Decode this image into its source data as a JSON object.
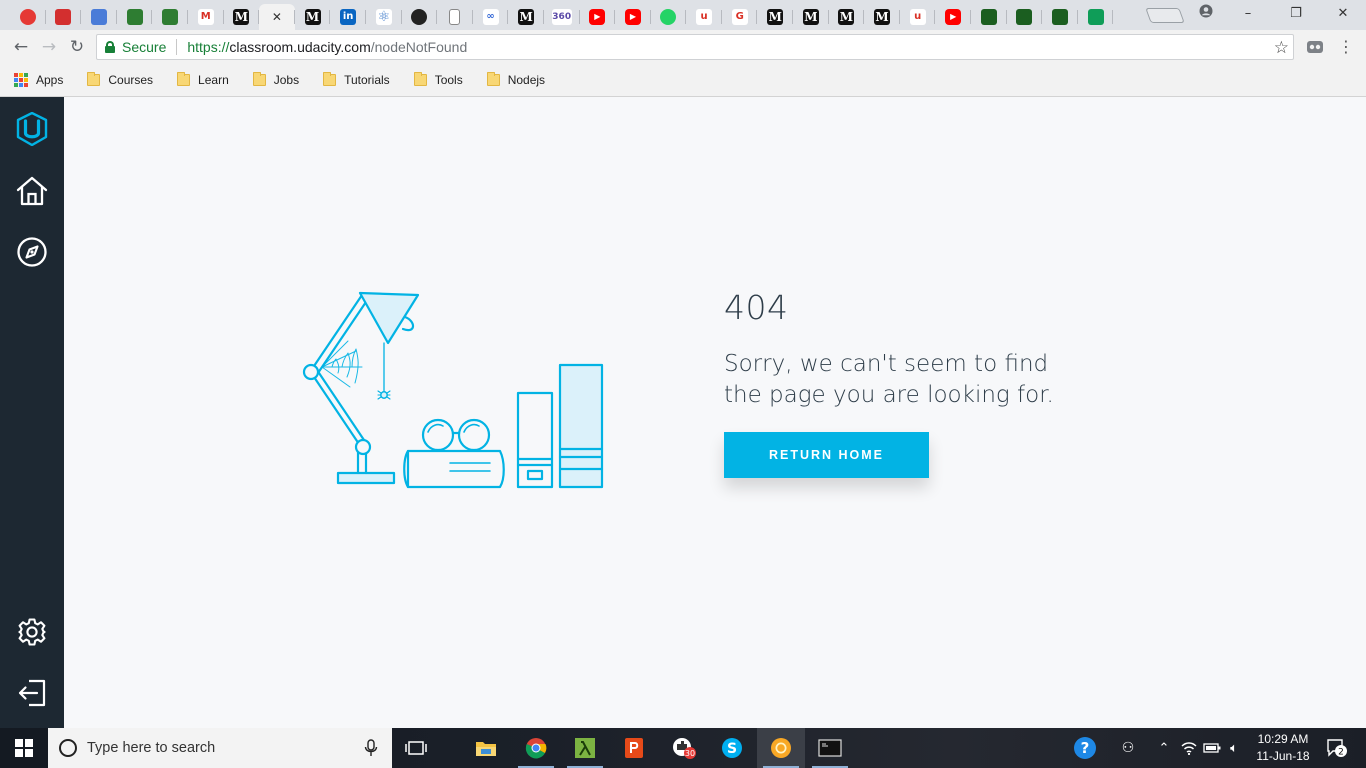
{
  "browser": {
    "tabs": [
      {
        "icon": "red-diamond-icon",
        "text": "",
        "bg": "#e53935",
        "active": false
      },
      {
        "icon": "red-figure-icon",
        "text": "",
        "bg": "#d32f2f",
        "active": false
      },
      {
        "icon": "gear-badge-icon",
        "text": "",
        "bg": "#4a7cd8",
        "active": false
      },
      {
        "icon": "hackerrank-icon",
        "text": "",
        "bg": "#2e7d32",
        "active": false
      },
      {
        "icon": "hackerrank-icon",
        "text": "",
        "bg": "#2e7d32",
        "active": false
      },
      {
        "icon": "gmail-icon",
        "text": "M",
        "bg": "#ffffff",
        "active": false
      },
      {
        "icon": "medium-icon",
        "text": "M",
        "bg": "#111111",
        "active": false
      },
      {
        "icon": "close-icon",
        "text": "✕",
        "bg": "#f2f2f2",
        "active": true
      },
      {
        "icon": "medium-icon",
        "text": "M",
        "bg": "#111111",
        "active": false
      },
      {
        "icon": "linkedin-icon",
        "text": "in",
        "bg": "#0a66c2",
        "active": false
      },
      {
        "icon": "react-icon",
        "text": "⚛",
        "bg": "#ffffff",
        "active": false
      },
      {
        "icon": "github-icon",
        "text": "",
        "bg": "#222222",
        "active": false
      },
      {
        "icon": "document-icon",
        "text": "",
        "bg": "#ffffff",
        "active": false
      },
      {
        "icon": "infinity-icon",
        "text": "∞",
        "bg": "#ffffff",
        "active": false
      },
      {
        "icon": "medium-icon",
        "text": "M",
        "bg": "#111111",
        "active": false
      },
      {
        "icon": "360-icon",
        "text": "360",
        "bg": "#ffffff",
        "active": false
      },
      {
        "icon": "youtube-icon",
        "text": "▶",
        "bg": "#ff0000",
        "active": false
      },
      {
        "icon": "youtube-icon",
        "text": "▶",
        "bg": "#ff0000",
        "active": false
      },
      {
        "icon": "whatsapp-icon",
        "text": "",
        "bg": "#25d366",
        "active": false
      },
      {
        "icon": "udemy-icon",
        "text": "u",
        "bg": "#ffffff",
        "active": false
      },
      {
        "icon": "google-icon",
        "text": "G",
        "bg": "#ffffff",
        "active": false
      },
      {
        "icon": "medium-icon",
        "text": "M",
        "bg": "#111111",
        "active": false
      },
      {
        "icon": "medium-icon",
        "text": "M",
        "bg": "#111111",
        "active": false
      },
      {
        "icon": "medium-icon",
        "text": "M",
        "bg": "#111111",
        "active": false
      },
      {
        "icon": "medium-icon",
        "text": "M",
        "bg": "#111111",
        "active": false
      },
      {
        "icon": "udemy-icon",
        "text": "u",
        "bg": "#ffffff",
        "active": false
      },
      {
        "icon": "youtube-icon",
        "text": "▶",
        "bg": "#ff0000",
        "active": false
      },
      {
        "icon": "mongodb-icon",
        "text": "",
        "bg": "#1b5e20",
        "active": false
      },
      {
        "icon": "mongodb-icon",
        "text": "",
        "bg": "#1b5e20",
        "active": false
      },
      {
        "icon": "mongodb-icon",
        "text": "",
        "bg": "#1b5e20",
        "active": false
      },
      {
        "icon": "sheets-icon",
        "text": "",
        "bg": "#0f9d58",
        "active": false
      }
    ],
    "address": {
      "secure_label": "Secure",
      "scheme": "https://",
      "host": "classroom.udacity.com",
      "path": "/nodeNotFound"
    },
    "bookmarks": [
      {
        "label": "Apps",
        "type": "apps"
      },
      {
        "label": "Courses",
        "type": "folder"
      },
      {
        "label": "Learn",
        "type": "folder"
      },
      {
        "label": "Jobs",
        "type": "folder"
      },
      {
        "label": "Tutorials",
        "type": "folder"
      },
      {
        "label": "Tools",
        "type": "folder"
      },
      {
        "label": "Nodejs",
        "type": "folder"
      }
    ]
  },
  "sidebar": {
    "top": [
      "udacity-logo-icon",
      "home-icon",
      "compass-icon"
    ],
    "bottom": [
      "settings-icon",
      "logout-icon"
    ],
    "accent": "#02b3e4"
  },
  "error": {
    "code": "404",
    "message_line1": "Sorry, we can't seem to find",
    "message_line2": "the page you are looking for.",
    "button_label": "RETURN HOME",
    "button_color": "#02b3e4",
    "text_color": "#2e3d49"
  },
  "taskbar": {
    "search_placeholder": "Type here to search",
    "apps": [
      "task-view-icon",
      "file-explorer-icon",
      "chrome-icon",
      "lambda-app-icon",
      "powerpoint-icon",
      "puzzle-app-icon",
      "skype-icon",
      "chrome-canary-icon",
      "terminal-icon"
    ],
    "notification_badge": "30",
    "time": "10:29 AM",
    "date": "11-Jun-18",
    "action_center_count": "2"
  }
}
